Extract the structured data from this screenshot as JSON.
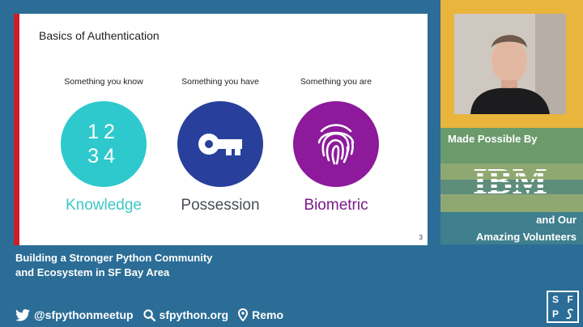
{
  "slide": {
    "title": "Basics of Authentication",
    "page_number": "3",
    "factors": [
      {
        "caption": "Something you know",
        "label": "Knowledge",
        "icon": "number-keypad-icon",
        "digits_row1": "12",
        "digits_row2": "34",
        "color": "#2ec9cc"
      },
      {
        "caption": "Something you have",
        "label": "Possession",
        "icon": "key-icon",
        "color": "#28409c"
      },
      {
        "caption": "Something you are",
        "label": "Biometric",
        "icon": "fingerprint-icon",
        "color": "#8c1a9b"
      }
    ]
  },
  "sponsor": {
    "heading": "Made Possible By",
    "sponsor_name": "IBM",
    "line1": "and Our",
    "line2": "Amazing Volunteers"
  },
  "event": {
    "line1": "Building a Stronger Python Community",
    "line2": "and Ecosystem in SF Bay Area"
  },
  "social": {
    "twitter": "@sfpythonmeetup",
    "website": "sfpython.org",
    "venue": "Remo"
  },
  "logo": {
    "letters": [
      "S",
      "F",
      "P",
      ""
    ]
  },
  "colors": {
    "background": "#2b6d96",
    "panel": "#e9b53d",
    "accent_red": "#cc1e27"
  }
}
